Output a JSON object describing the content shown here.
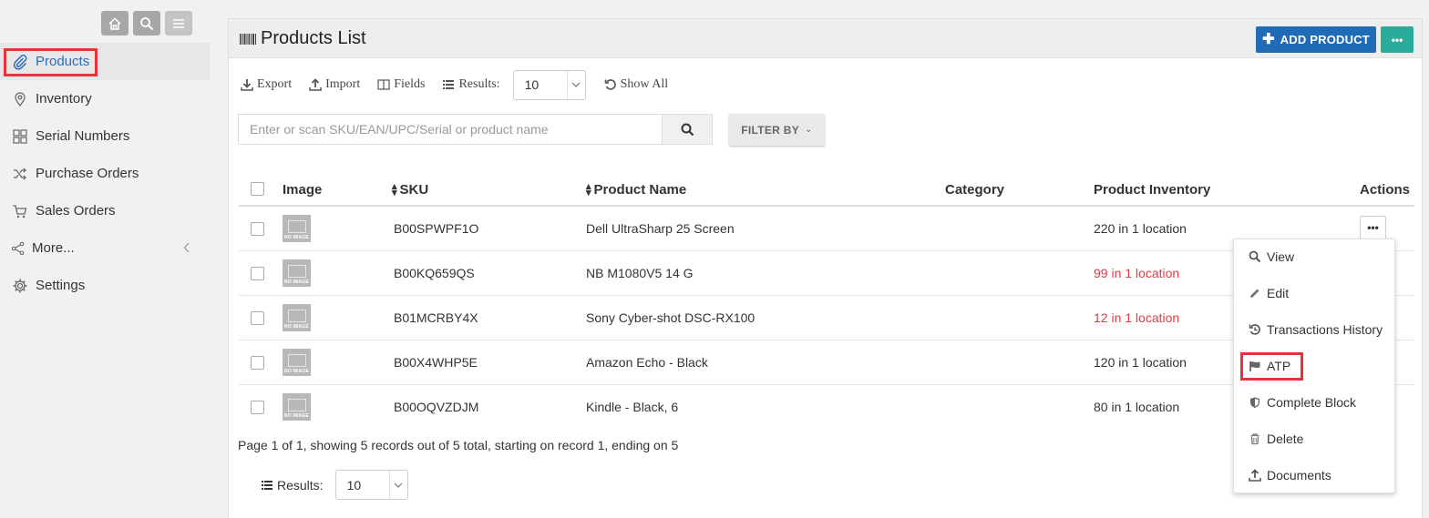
{
  "sidebar": {
    "items": [
      {
        "label": "Products",
        "icon": "paperclip-icon"
      },
      {
        "label": "Inventory",
        "icon": "map-pin-icon"
      },
      {
        "label": "Serial Numbers",
        "icon": "grid-icon"
      },
      {
        "label": "Purchase Orders",
        "icon": "shuffle-icon"
      },
      {
        "label": "Sales Orders",
        "icon": "cart-icon"
      },
      {
        "label": "More...",
        "icon": "share-icon"
      },
      {
        "label": "Settings",
        "icon": "gear-icon"
      }
    ]
  },
  "header": {
    "title": "Products List",
    "add_label": "ADD PRODUCT",
    "more_label": "•••"
  },
  "toolbar": {
    "export_label": "Export",
    "import_label": "Import",
    "fields_label": "Fields",
    "results_label": "Results:",
    "results_value": "10",
    "show_all_label": "Show All"
  },
  "search": {
    "placeholder": "Enter or scan SKU/EAN/UPC/Serial or product name",
    "filter_label": "FILTER BY"
  },
  "table": {
    "columns": {
      "image": "Image",
      "sku": "SKU",
      "name": "Product Name",
      "category": "Category",
      "inventory": "Product Inventory",
      "actions": "Actions"
    },
    "thumb_text": "NO IMAGE",
    "action_label": "•••",
    "rows": [
      {
        "sku": "B00SPWPF1O",
        "name": "Dell UltraSharp 25 Screen",
        "category": "",
        "inventory": "220 in 1 location"
      },
      {
        "sku": "B00KQ659QS",
        "name": "NB M1080V5 14 G",
        "category": "",
        "inventory": "99 in 1 location"
      },
      {
        "sku": "B01MCRBY4X",
        "name": "Sony Cyber-shot DSC-RX100",
        "category": "",
        "inventory": "12 in 1 location"
      },
      {
        "sku": "B00X4WHP5E",
        "name": "Amazon Echo - Black",
        "category": "",
        "inventory": "120 in 1 location"
      },
      {
        "sku": "B00OQVZDJM",
        "name": "Kindle - Black, 6",
        "category": "",
        "inventory": "80 in 1 location"
      }
    ]
  },
  "pagination": {
    "info": "Page 1 of 1, showing 5 records out of 5 total, starting on record 1, ending on 5",
    "results_label": "Results:",
    "results_value": "10"
  },
  "menu": {
    "items": [
      {
        "label": "View",
        "icon": "search-icon"
      },
      {
        "label": "Edit",
        "icon": "pencil-icon"
      },
      {
        "label": "Transactions History",
        "icon": "history-icon"
      },
      {
        "label": "ATP",
        "icon": "flag-icon"
      },
      {
        "label": "Complete Block",
        "icon": "shield-icon"
      },
      {
        "label": "Delete",
        "icon": "trash-icon"
      },
      {
        "label": "Documents",
        "icon": "upload-icon"
      }
    ]
  },
  "colors": {
    "primary": "#1f6bb6",
    "teal": "#2aab9b",
    "active_link": "#2d6db5",
    "low_stock": "#e03b46",
    "highlight": "#e8313a"
  }
}
